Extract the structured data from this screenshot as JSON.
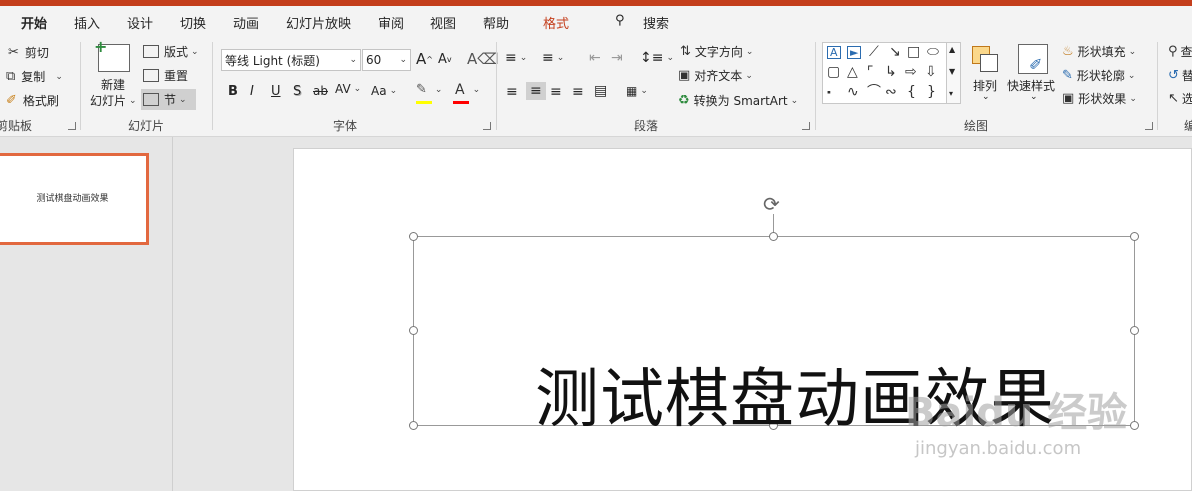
{
  "tabs": [
    "开始",
    "插入",
    "设计",
    "切换",
    "动画",
    "幻灯片放映",
    "审阅",
    "视图",
    "帮助",
    "格式"
  ],
  "search_label": "搜索",
  "clipboard": {
    "cut": "剪切",
    "copy": "复制",
    "format_painter": "格式刷",
    "group_label": "剪贴板"
  },
  "slides_group": {
    "new_slide": "新建",
    "new_slide2": "幻灯片",
    "layout": "版式",
    "reset": "重置",
    "section": "节",
    "group_label": "幻灯片"
  },
  "font_group": {
    "font_name": "等线 Light (标题)",
    "font_size": "60",
    "group_label": "字体",
    "bold": "B",
    "italic": "I",
    "underline": "U",
    "shadow": "S",
    "strike": "ab",
    "spacing": "AV",
    "case": "Aa",
    "grow": "A",
    "shrink": "A"
  },
  "paragraph_group": {
    "text_direction": "文字方向",
    "align_text": "对齐文本",
    "smartart": "转换为 SmartArt",
    "group_label": "段落"
  },
  "drawing_group": {
    "arrange": "排列",
    "quick_styles": "快速样式",
    "shape_fill": "形状填充",
    "shape_outline": "形状轮廓",
    "shape_effects": "形状效果",
    "group_label": "绘图"
  },
  "editing_group": {
    "find": "查",
    "replace": "替",
    "select": "选",
    "group_label": "编"
  },
  "slide": {
    "title_text": "测试棋盘动画效果",
    "thumbnail_text": "测试棋盘动画效果"
  },
  "watermark": {
    "brand": "Baidu 经验",
    "url": "jingyan.baidu.com"
  },
  "colors": {
    "accent": "#c43e1c",
    "highlight": "#ffff00",
    "font_color": "#ff0000",
    "thumb_border": "#e2683f"
  }
}
